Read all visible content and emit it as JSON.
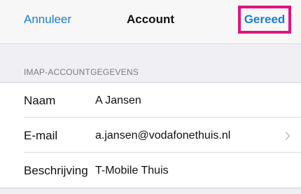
{
  "navbar": {
    "cancel_label": "Annuleer",
    "title": "Account",
    "done_label": "Gereed"
  },
  "section": {
    "header": "IMAP-ACCOUNTGEGEVENS"
  },
  "fields": [
    {
      "label": "Naam",
      "value": "A Jansen"
    },
    {
      "label": "E-mail",
      "value": "a.jansen@vodafonethuis.nl"
    },
    {
      "label": "Beschrijving",
      "value": "T-Mobile Thuis"
    }
  ],
  "colors": {
    "accent": "#1a7dd6",
    "highlight_border": "#e0157f",
    "background": "#efeff4"
  },
  "icons": {
    "email_row_accessory": "chevron-right-icon"
  }
}
